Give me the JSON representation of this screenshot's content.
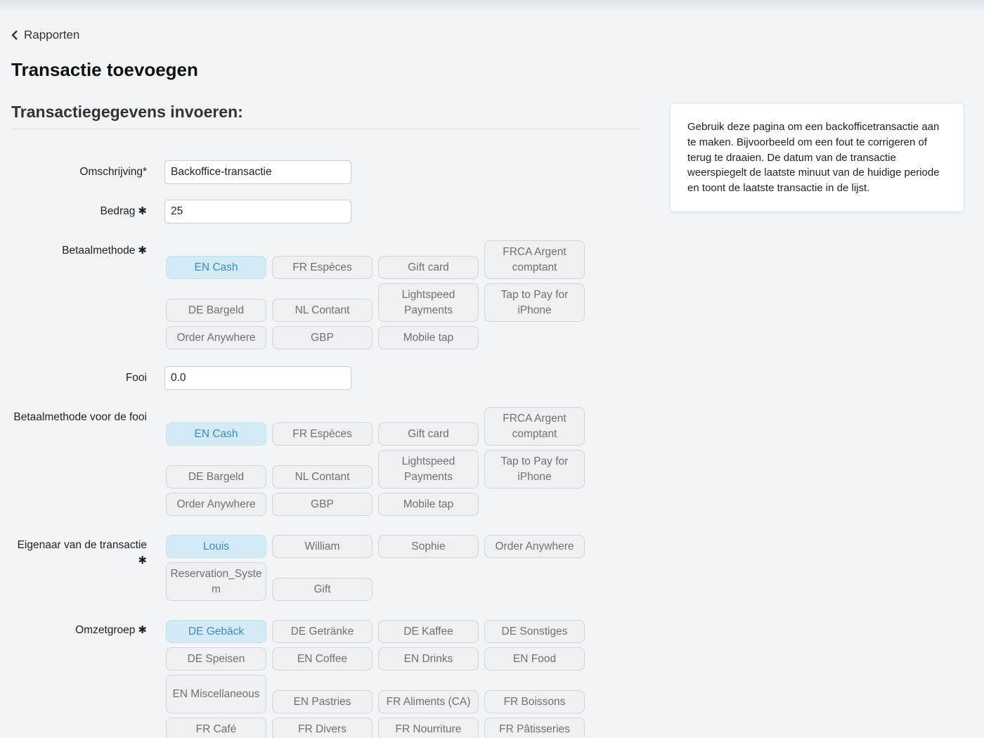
{
  "back_label": "Rapporten",
  "page_title": "Transactie toevoegen",
  "section_title": "Transactiegegevens invoeren:",
  "fields": {
    "description_label": "Omschrijving*",
    "description_value": "Backoffice-transactie",
    "amount_label": "Bedrag",
    "amount_value": "25",
    "payment_method_label": "Betaalmethode",
    "tip_label": "Fooi",
    "tip_value": "0.0",
    "tip_payment_method_label": "Betaalmethode voor de fooi",
    "owner_label": "Eigenaar van de transactie",
    "revenue_group_label": "Omzetgroep"
  },
  "required_glyph": "✱",
  "payment_methods": [
    "EN Cash",
    "FR Espèces",
    "Gift card",
    "FRCA Argent comptant",
    "DE Bargeld",
    "NL Contant",
    "Lightspeed Payments",
    "Tap to Pay for iPhone",
    "Order Anywhere",
    "GBP",
    "Mobile tap"
  ],
  "selected_payment_method": "EN Cash",
  "selected_tip_payment_method": "EN Cash",
  "owners": [
    "Louis",
    "William",
    "Sophie",
    "Order Anywhere",
    "Reservation_System",
    "Gift"
  ],
  "selected_owner": "Louis",
  "revenue_groups": [
    "DE Gebäck",
    "DE Getränke",
    "DE Kaffee",
    "DE Sonstiges",
    "DE Speisen",
    "EN Coffee",
    "EN Drinks",
    "EN Food",
    "EN Miscellaneous",
    "EN Pastries",
    "FR Aliments (CA)",
    "FR Boissons",
    "FR Café",
    "FR Divers",
    "FR Nourriture",
    "FR Pâtisseries"
  ],
  "selected_revenue_group": "DE Gebäck",
  "info_text": "Gebruik deze pagina om een backofficetransactie aan te maken. Bijvoorbeeld om een fout te corrigeren of terug te draaien. De datum van de transactie weerspiegelt de laatste minuut van de huidige periode en toont de laatste transactie in de lijst.",
  "colors": {
    "background": "#f1f5f8",
    "selected_chip_bg": "#d4ebf6",
    "selected_chip_text": "#3a8dc0",
    "chip_bg": "#eef0f2"
  }
}
